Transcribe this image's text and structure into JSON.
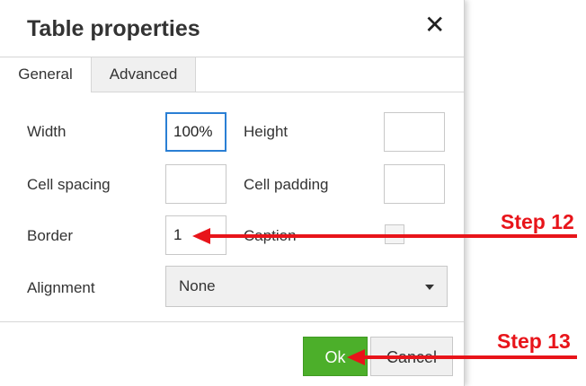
{
  "dialog": {
    "title": "Table properties",
    "close_label": "✕"
  },
  "tabs": [
    {
      "label": "General",
      "active": true
    },
    {
      "label": "Advanced",
      "active": false
    }
  ],
  "fields": {
    "width": {
      "label": "Width",
      "value": "100%"
    },
    "height": {
      "label": "Height",
      "value": ""
    },
    "cell_spacing": {
      "label": "Cell spacing",
      "value": ""
    },
    "cell_padding": {
      "label": "Cell padding",
      "value": ""
    },
    "border": {
      "label": "Border",
      "value": "1"
    },
    "caption": {
      "label": "Caption",
      "checked": false
    },
    "alignment": {
      "label": "Alignment",
      "selected": "None"
    }
  },
  "buttons": {
    "ok": "Ok",
    "cancel": "Cancel"
  },
  "annotations": {
    "step12": "Step 12",
    "step13": "Step 13",
    "arrow_color": "#e8141a"
  },
  "colors": {
    "ok_button": "#4caf2a",
    "focus_border": "#2a7fd4"
  }
}
